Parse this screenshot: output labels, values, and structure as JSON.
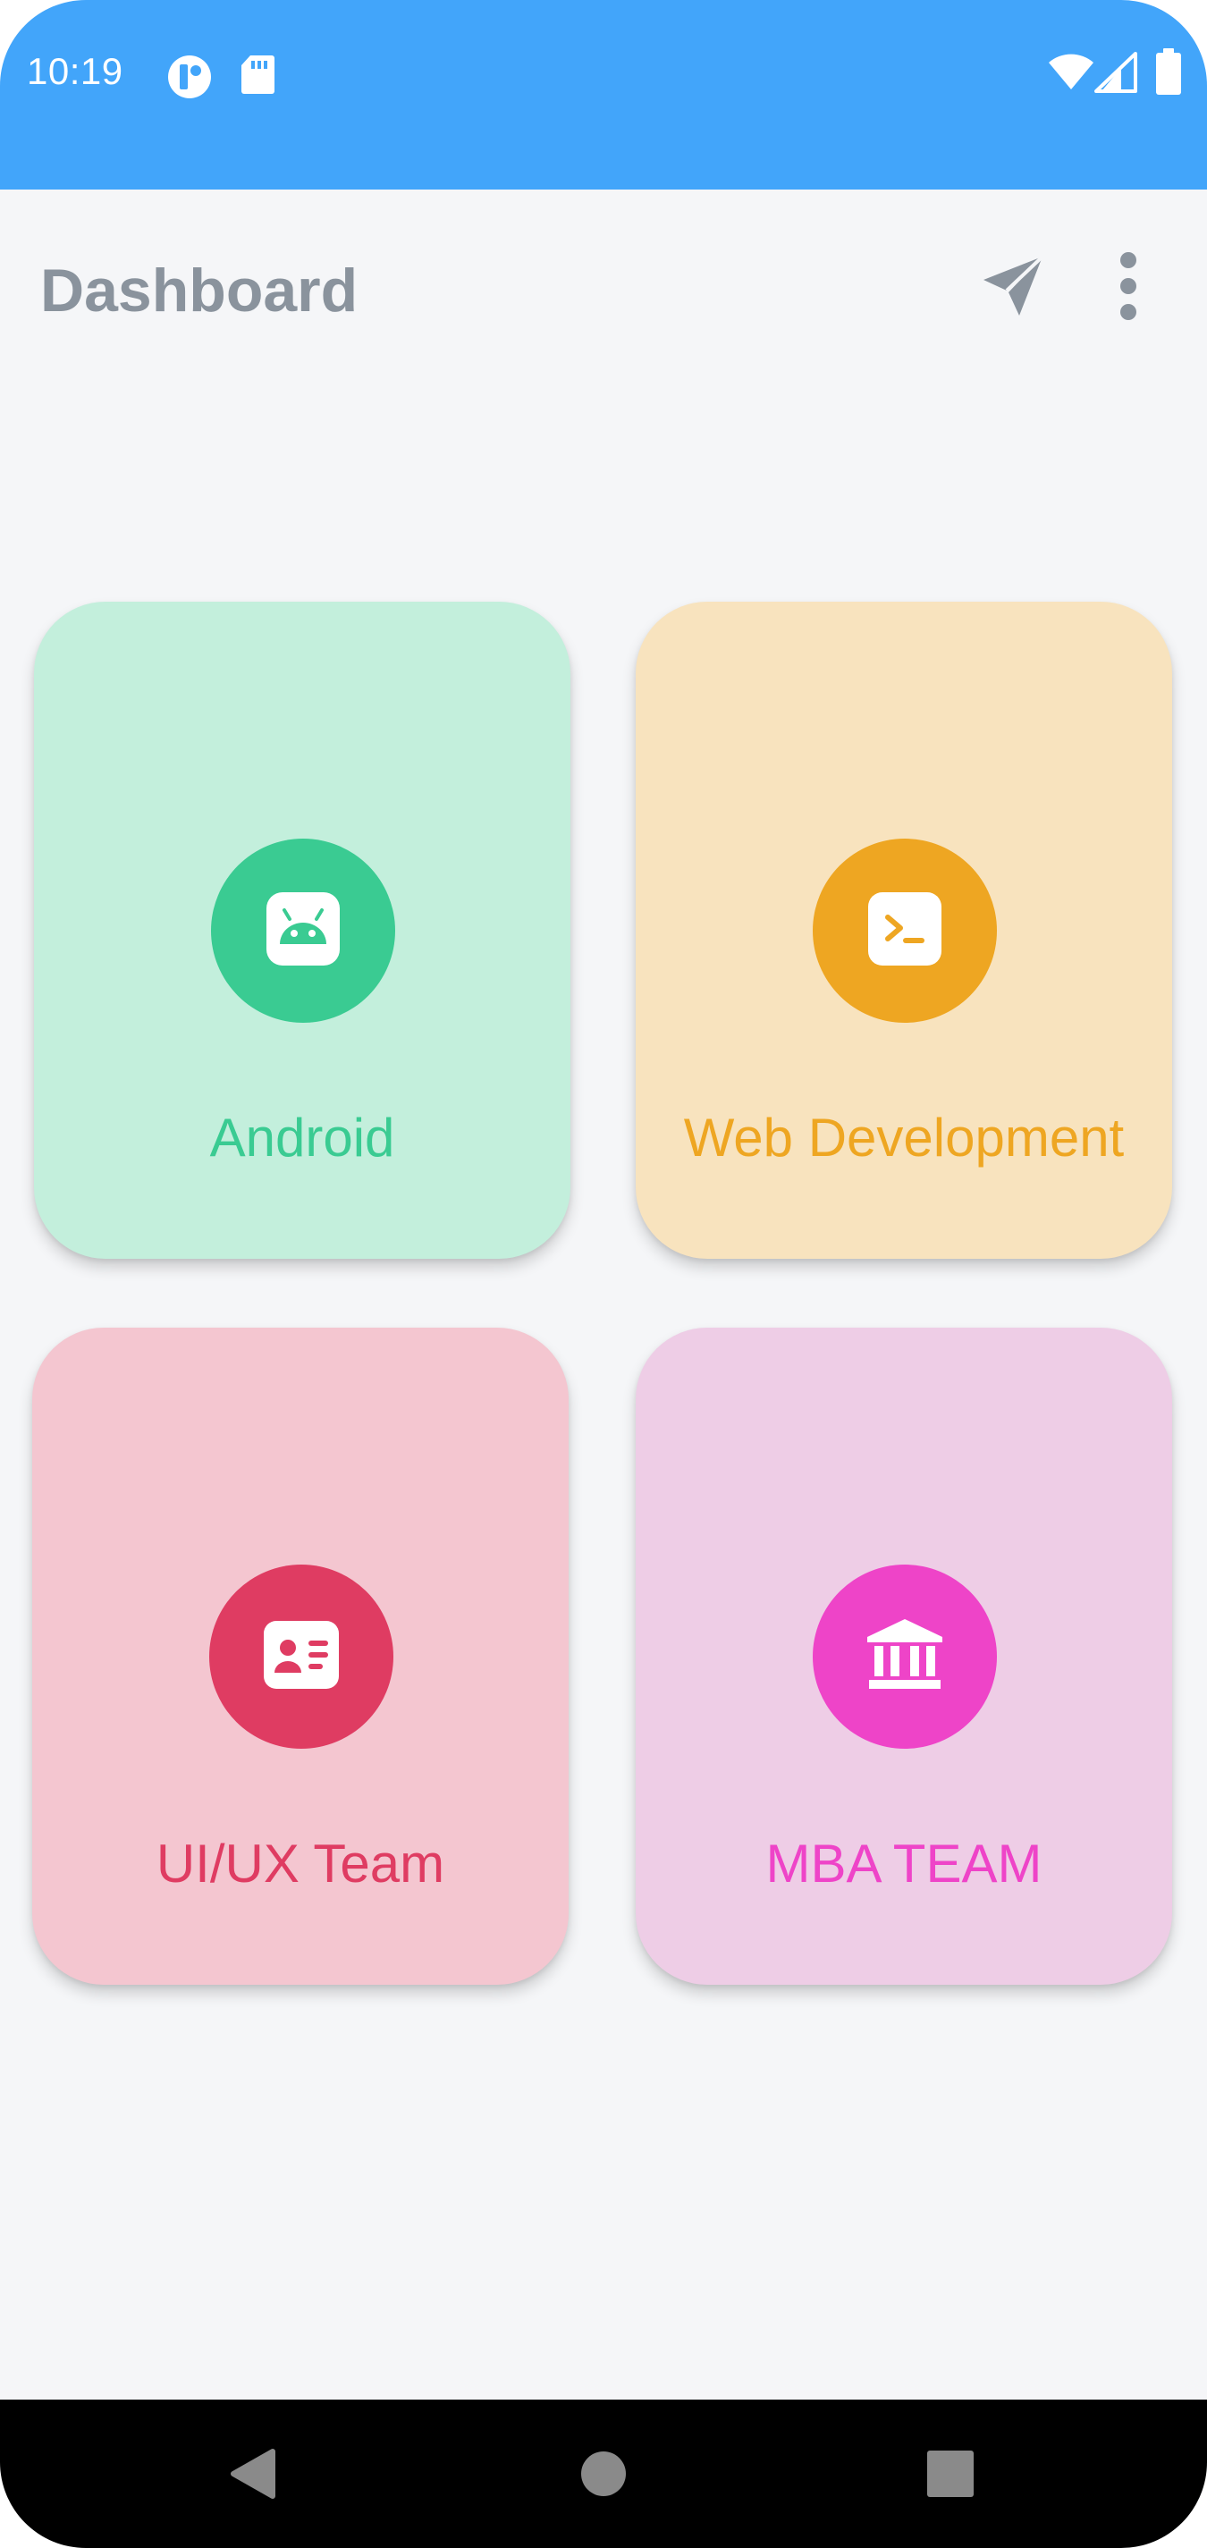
{
  "status_bar": {
    "time": "10:19",
    "left_icons": [
      "app-notification-icon",
      "sd-card-icon"
    ],
    "right_icons": [
      "wifi-icon",
      "cell-signal-icon",
      "battery-icon"
    ],
    "color": "#42a5fa"
  },
  "app_bar": {
    "title": "Dashboard",
    "actions": [
      "send-icon",
      "more-vert-icon"
    ]
  },
  "cards": [
    {
      "label": "Android",
      "icon": "android-icon",
      "bg": "#c3efdc",
      "accent": "#3acb92"
    },
    {
      "label": "Web Development",
      "icon": "terminal-icon",
      "bg": "#f8e3be",
      "accent": "#eea622"
    },
    {
      "label": "UI/UX Team",
      "icon": "id-card-icon",
      "bg": "#f4c6d0",
      "accent": "#df3c62"
    },
    {
      "label": "MBA TEAM",
      "icon": "bank-icon",
      "bg": "#eecde6",
      "accent": "#ee44c8"
    }
  ],
  "nav_bar": {
    "buttons": [
      "back-icon",
      "home-icon",
      "recents-icon"
    ]
  }
}
